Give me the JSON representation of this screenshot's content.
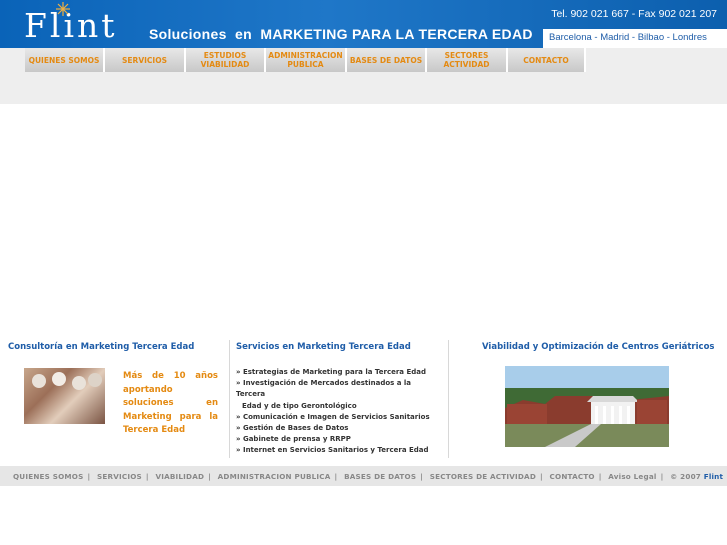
{
  "header": {
    "logo_text": "Flint",
    "tagline_prefix": "Soluciones  en  ",
    "tagline_main": "MARKETING  PARA LA TERCERA EDAD",
    "contact": "Tel. 902 021 667  -  Fax 902 021 207",
    "cities": "Barcelona - Madrid - Bilbao - Londres",
    "colors": {
      "bar": "#1f77c8",
      "accent": "#e48a12",
      "link": "#1f5da8"
    }
  },
  "nav": {
    "items": [
      {
        "label": "QUIENES SOMOS"
      },
      {
        "label": "SERVICIOS"
      },
      {
        "label": "ESTUDIOS\nVIABILIDAD"
      },
      {
        "label": "ADMINISTRACION\nPUBLICA"
      },
      {
        "label": "BASES DE DATOS"
      },
      {
        "label": "SECTORES\nACTIVIDAD"
      },
      {
        "label": "CONTACTO"
      }
    ]
  },
  "sections": {
    "consultoria": {
      "title": "Consultoría en Marketing Tercera Edad",
      "text": "Más de 10 años aportando soluciones en Marketing para la Tercera Edad"
    },
    "servicios": {
      "title": "Servicios en Marketing Tercera Edad",
      "items": [
        "» Estrategias de Marketing para la Tercera Edad",
        "» Investigación de Mercados destinados a la Tercera",
        "Edad y de tipo Gerontológico",
        "» Comunicación e Imagen de Servicios Sanitarios",
        "» Gestión de Bases de Datos",
        "» Gabinete de prensa y RRPP",
        "» Internet en Servicios Sanitarios y Tercera Edad"
      ]
    },
    "viabilidad": {
      "title": "Viabilidad y Optimización de Centros Geriátricos"
    }
  },
  "footer": {
    "links": [
      "QUIENES SOMOS",
      "SERVICIOS",
      "VIABILIDAD",
      "ADMINISTRACION PUBLICA",
      "BASES DE DATOS",
      "SECTORES DE ACTIVIDAD",
      "CONTACTO",
      "Aviso Legal",
      "© 2007"
    ],
    "brand": "Flint"
  }
}
